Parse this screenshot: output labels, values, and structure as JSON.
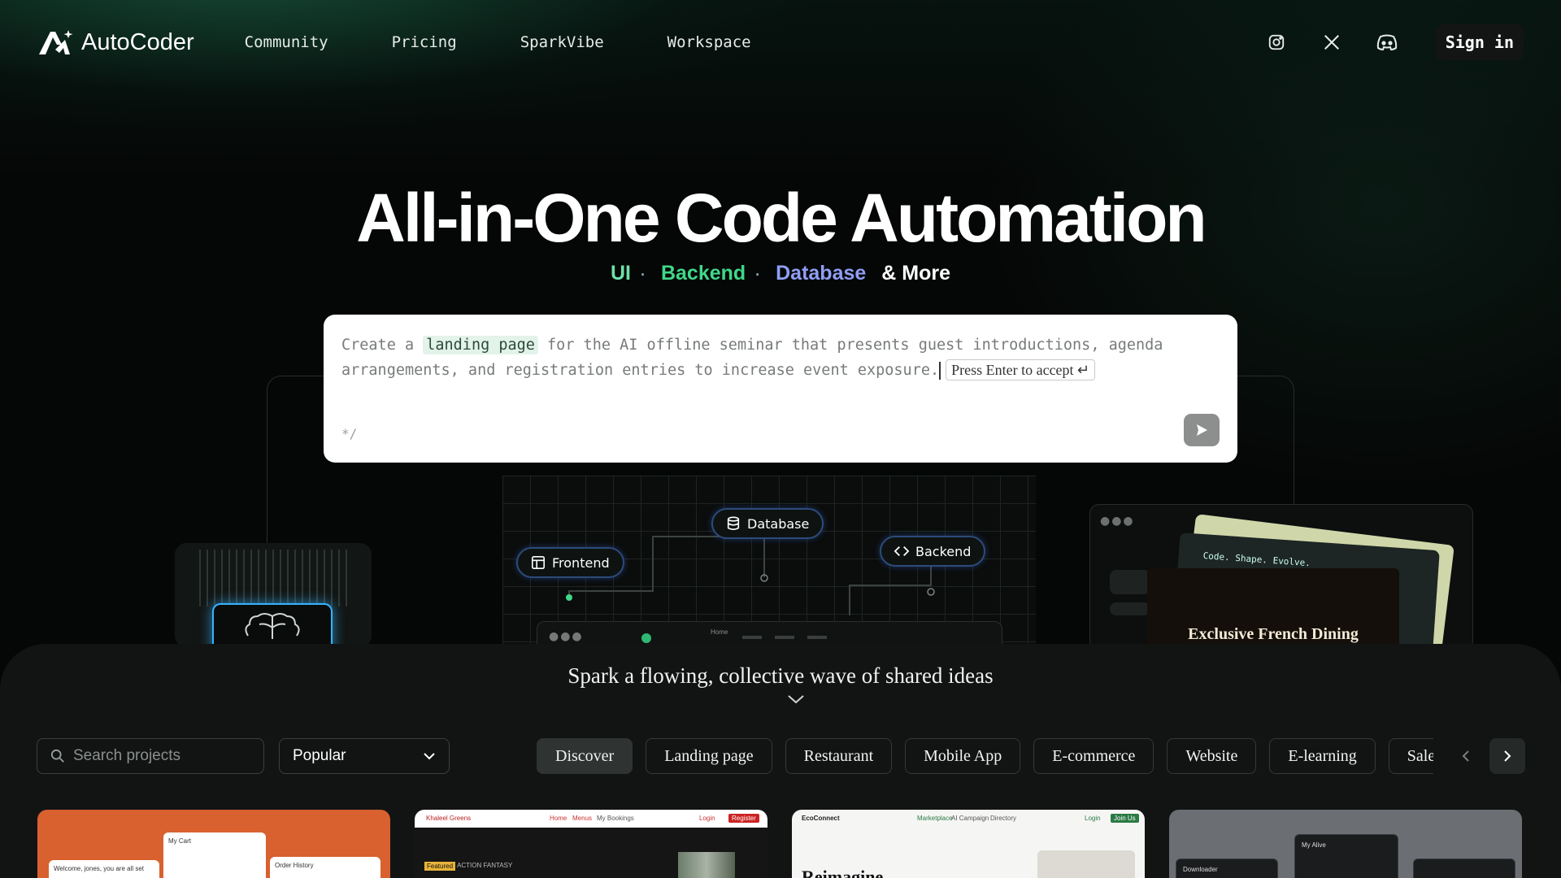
{
  "brand": {
    "name": "AutoCoder"
  },
  "nav": {
    "links": [
      "Community",
      "Pricing",
      "SparkVibe",
      "Workspace"
    ],
    "social": [
      "instagram-icon",
      "x-icon",
      "discord-icon"
    ],
    "signin": "Sign in"
  },
  "hero": {
    "title": "All-in-One Code Automation",
    "sub": {
      "ui": "UI",
      "backend": "Backend",
      "database": "Database",
      "more": "& More",
      "sep": "·"
    }
  },
  "prompt": {
    "text_before": "Create a ",
    "highlight": "landing page",
    "text_after": " for the AI offline seminar that presents guest introductions, agenda arrangements, and registration entries to increase event exposure.",
    "accept_hint": "Press Enter to accept ↵",
    "icon": "*/"
  },
  "illustration": {
    "chips": {
      "frontend": "Frontend",
      "database": "Database",
      "backend": "Backend"
    },
    "mini_nav": "Home",
    "preview_code": "Code. Shape. Evolve.",
    "preview_title": "Exclusive French Dining"
  },
  "explore": {
    "tagline": "Spark a flowing, collective wave of shared ideas",
    "search_placeholder": "Search projects",
    "sort_selected": "Popular",
    "categories": [
      "Discover",
      "Landing page",
      "Restaurant",
      "Mobile App",
      "E-commerce",
      "Website",
      "E-learning",
      "Sales"
    ]
  },
  "cards": [
    {
      "labels": [
        "Welcome, jones, you are all set",
        "My Cart",
        "Order History"
      ]
    },
    {
      "labels": [
        "Khaleel Greens",
        "Home",
        "Menus",
        "My Bookings",
        "Login",
        "Register",
        "Featured",
        "ACTION FANTASY"
      ]
    },
    {
      "labels": [
        "EcoConnect",
        "Marketplace",
        "AI Campaign",
        "Directory",
        "Login",
        "Join Us",
        "Reimagine"
      ]
    },
    {
      "labels": [
        "Downloader",
        "My Alive"
      ]
    }
  ],
  "colors": {
    "accent_green": "#3fd889",
    "accent_blue": "#8f9ef4",
    "chip_border": "#2d4a7a",
    "glow_blue": "#36b3ff"
  }
}
